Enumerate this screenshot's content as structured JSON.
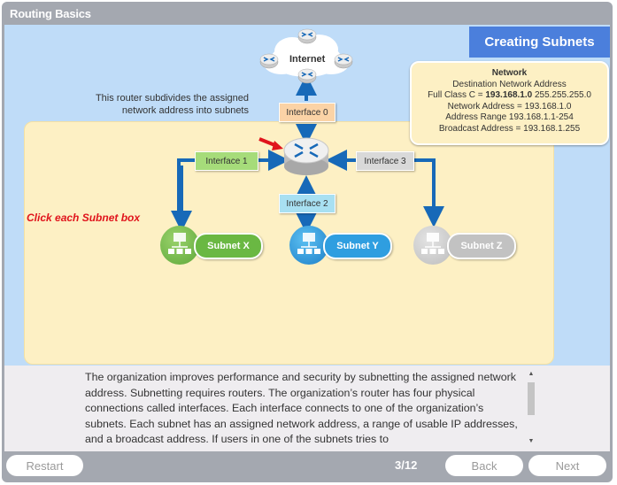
{
  "window": {
    "title": "Routing Basics"
  },
  "heading": "Creating Subnets",
  "network_info": {
    "title": "Network",
    "line1": "Destination Network Address",
    "line2_prefix": "Full Class C = ",
    "line2_bold": "193.168.1.0",
    "line2_suffix": " 255.255.255.0",
    "line3": "Network Address = 193.168.1.0",
    "line4": "Address Range 193.168.1.1-254",
    "line5": "Broadcast Address = 193.168.1.255"
  },
  "diagram": {
    "internet_label": "Internet",
    "router_note": "This router subdivides the assigned network address into subnets",
    "interfaces": [
      {
        "label": "Interface 0",
        "color": "#fbd3a6"
      },
      {
        "label": "Interface 1",
        "color": "#a6dc7a"
      },
      {
        "label": "Interface 2",
        "color": "#a8e0f2"
      },
      {
        "label": "Interface 3",
        "color": "#d9d9d9"
      }
    ],
    "instruction": "Click each Subnet box",
    "subnets": [
      {
        "label": "Subnet X",
        "color": "#6ab843"
      },
      {
        "label": "Subnet Y",
        "color": "#2f9ee0"
      },
      {
        "label": "Subnet Z",
        "color": "#c2c2c2"
      }
    ],
    "arrow_color": "#1769b8",
    "pointer_color": "#e0141c"
  },
  "body_text": "The organization improves performance and security by subnetting the assigned network address. Subnetting requires routers. The organization’s router has four physical connections called interfaces. Each interface connects to one of the organization’s subnets. Each subnet has an assigned network address, a range of usable IP addresses, and a broadcast address. If users in one of the subnets tries to",
  "footer": {
    "restart_label": "Restart",
    "page_indicator": "3/12",
    "back_label": "Back",
    "next_label": "Next"
  }
}
